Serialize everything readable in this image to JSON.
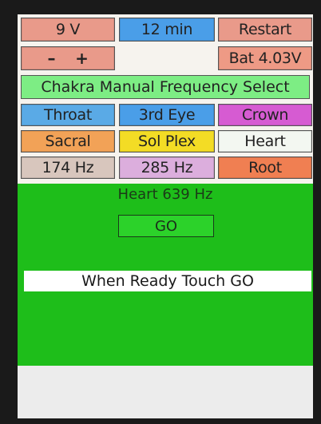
{
  "top_row": {
    "voltage": "9 V",
    "duration": "12 min",
    "restart": "Restart"
  },
  "second_row": {
    "minus": "–",
    "plus": "+",
    "battery": "Bat 4.03V"
  },
  "title": "Chakra Manual Frequency Select",
  "chakra_buttons": [
    {
      "label": "Throat"
    },
    {
      "label": "3rd Eye"
    },
    {
      "label": "Crown"
    },
    {
      "label": "Sacral"
    },
    {
      "label": "Sol Plex"
    },
    {
      "label": "Heart"
    },
    {
      "label": "174 Hz"
    },
    {
      "label": "285 Hz"
    },
    {
      "label": "Root"
    }
  ],
  "status": {
    "selected": "Heart 639 Hz",
    "go_label": "GO",
    "prompt": "When Ready Touch GO"
  },
  "colors": {
    "voltage_bg": "#e99a8a",
    "duration_bg": "#4a9ee8",
    "restart_bg": "#e99a8a",
    "pm_bg": "#e99a8a",
    "battery_bg": "#ee9a85",
    "title_bg": "#7ded84",
    "throat_bg": "#5aaae6",
    "third_eye_bg": "#4a9ee8",
    "crown_bg": "#d65bd2",
    "sacral_bg": "#f2a257",
    "sol_plex_bg": "#f3dc25",
    "heart_bg": "#f3f7f1",
    "hz174_bg": "#d8c6bd",
    "hz285_bg": "#dcaedd",
    "root_bg": "#f07f52",
    "panel_green": "#1ebe1a"
  }
}
